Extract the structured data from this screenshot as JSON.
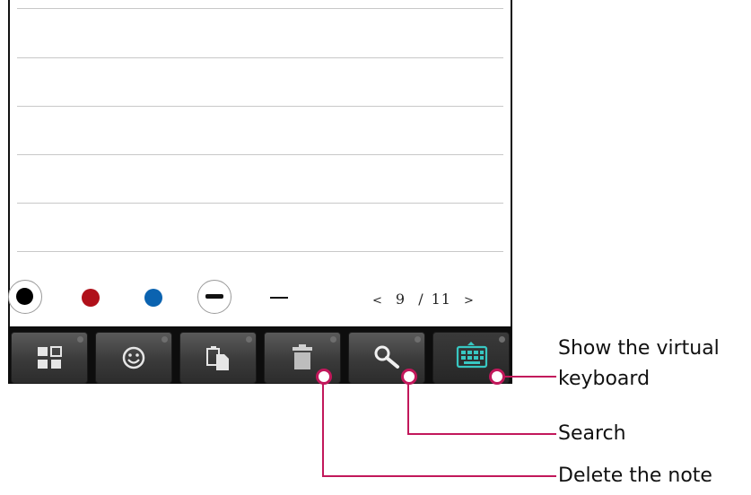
{
  "pager": {
    "open": "<",
    "current": "9",
    "separator": "/",
    "total": "11",
    "close": ">"
  },
  "pen_colors": {
    "black": "#000000",
    "red": "#b0101a",
    "blue": "#0b63b0"
  },
  "toolbar": {
    "buttons": [
      {
        "icon": "grid-view-icon"
      },
      {
        "icon": "smiley-icon"
      },
      {
        "icon": "paste-icon"
      },
      {
        "icon": "trash-icon"
      },
      {
        "icon": "search-icon"
      },
      {
        "icon": "keyboard-icon",
        "active": true,
        "accent": "#38c7c2"
      }
    ]
  },
  "callouts": {
    "keyboard_line1": "Show the virtual",
    "keyboard_line2": "keyboard",
    "search": "Search",
    "delete": "Delete the note"
  },
  "callout_color": "#c2185b"
}
